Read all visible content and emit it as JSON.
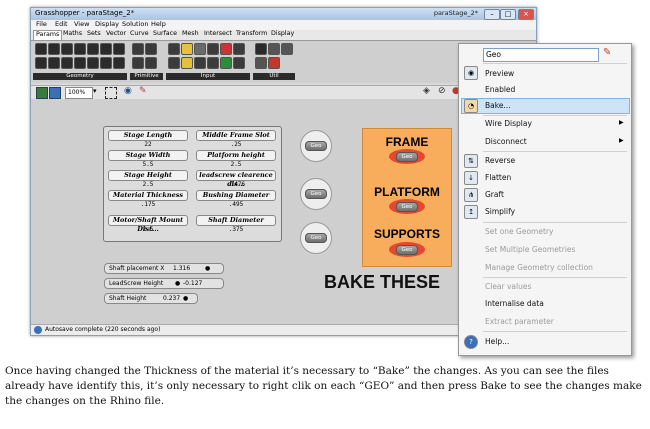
{
  "window": {
    "title": "Grasshopper - paraStage_2*",
    "doc_name": "paraStage_2*",
    "menu": [
      "File",
      "Edit",
      "View",
      "Display",
      "Solution",
      "Help"
    ],
    "tabs": [
      "Params",
      "Maths",
      "Sets",
      "Vector",
      "Curve",
      "Surface",
      "Mesh",
      "Intersect",
      "Transform",
      "Display"
    ],
    "ribbon_groups": [
      "Geometry",
      "Primitive",
      "Input",
      "Util"
    ],
    "zoom": "100%",
    "status": "Autosave complete (220 seconds ago)"
  },
  "params": [
    {
      "label": "Stage Length",
      "value": "22"
    },
    {
      "label": "Middle Frame Slot",
      "value": ".25"
    },
    {
      "label": "Stage Width",
      "value": "5.5"
    },
    {
      "label": "Platform height",
      "value": "2.5"
    },
    {
      "label": "Stage Height",
      "value": "2.5"
    },
    {
      "label": "leadscrew clearence dis...",
      "value": ".1476"
    },
    {
      "label": "Material Thickness",
      "value": ".175"
    },
    {
      "label": "Bushing Diameter",
      "value": ".495"
    },
    {
      "label": "Motor/Shaft Mount Dist...",
      "value": "2.5"
    },
    {
      "label": "Shaft Diameter",
      "value": ".375"
    }
  ],
  "sliders": [
    {
      "label": "Shaft placement X",
      "value": "1.316"
    },
    {
      "label": "LeadScrew Height",
      "value": "-0.127"
    },
    {
      "label": "Shaft Height",
      "value": "0.237"
    }
  ],
  "geo_label": "Geo",
  "groups": [
    "FRAME",
    "PLATFORM",
    "SUPPORTS"
  ],
  "bake_text": "BAKE THESE",
  "context_menu": {
    "search_value": "Geo",
    "items": [
      {
        "label": "Preview",
        "icon": "preview-icon",
        "disabled": false
      },
      {
        "label": "Enabled",
        "icon": "",
        "disabled": false
      },
      {
        "label": "Bake...",
        "icon": "bake-icon",
        "disabled": false,
        "highlight": true
      },
      {
        "label": "Wire Display",
        "icon": "",
        "disabled": false,
        "submenu": true
      },
      {
        "label": "Disconnect",
        "icon": "",
        "disabled": false,
        "submenu": true
      },
      {
        "label": "Reverse",
        "icon": "reverse-icon",
        "disabled": false
      },
      {
        "label": "Flatten",
        "icon": "flatten-icon",
        "disabled": false
      },
      {
        "label": "Graft",
        "icon": "graft-icon",
        "disabled": false
      },
      {
        "label": "Simplify",
        "icon": "simplify-icon",
        "disabled": false
      },
      {
        "label": "Set one Geometry",
        "icon": "",
        "disabled": true
      },
      {
        "label": "Set Multiple Geometries",
        "icon": "",
        "disabled": true
      },
      {
        "label": "Manage Geometry collection",
        "icon": "",
        "disabled": true
      },
      {
        "label": "Clear values",
        "icon": "",
        "disabled": true
      },
      {
        "label": "Internalise data",
        "icon": "",
        "disabled": false
      },
      {
        "label": "Extract parameter",
        "icon": "",
        "disabled": true
      },
      {
        "label": "Help...",
        "icon": "help-icon",
        "disabled": false
      }
    ]
  },
  "caption": "Once having changed the Thickness of the material it’s necessary to “Bake” the changes. As you can see the files already have identify this, it’s only necessary to right clik on each “GEO” and then press Bake to see the changes make the changes on the Rhino file."
}
